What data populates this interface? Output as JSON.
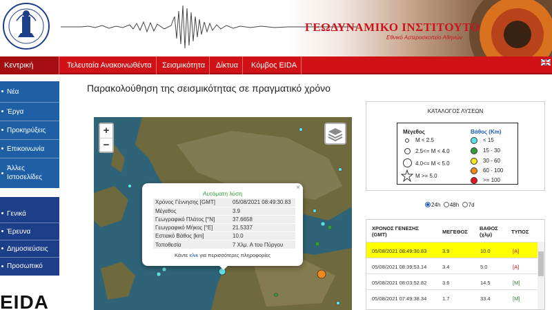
{
  "header": {
    "title": "ΓΕΩΔΥΝΑΜΙΚΟ ΙΝΣΤΙΤΟΥΤΟ",
    "subtitle": "Εθνικό Αστεροσκοπείο Αθηνών",
    "seal_text": "OBSERVATORY ATHENS"
  },
  "nav": {
    "items": [
      {
        "label": "Κεντρική Σελίδα"
      },
      {
        "label": "Τελευταία Ανακοινωθέντα"
      },
      {
        "label": "Σεισμικότητα"
      },
      {
        "label": "Δίκτυα"
      },
      {
        "label": "Κόμβος EIDA"
      }
    ]
  },
  "sidebar": {
    "group1": [
      "Νέα",
      "Έργα",
      "Προκηρύξεις",
      "Επικοινωνία",
      "Άλλες Ιστοσελίδες"
    ],
    "group2": [
      "Γενικά",
      "Έρευνα",
      "Δημοσιεύσεις",
      "Προσωπικό"
    ],
    "logo": "EIDA"
  },
  "main": {
    "title": "Παρακολούθηση της σεισμικότητας σε πραγματικό χρόνο"
  },
  "map": {
    "zoom_in": "+",
    "zoom_out": "−",
    "popup": {
      "title": "Αυτόματη λύση",
      "close": "×",
      "rows": [
        {
          "k": "Χρόνος Γέννησης [GMT]",
          "v": "05/08/2021 08:49:30.83"
        },
        {
          "k": "Μέγεθος",
          "v": "3.9"
        },
        {
          "k": "Γεωγραφικό Πλάτος [°N]",
          "v": "37.6658"
        },
        {
          "k": "Γεωγραφικό Μήκος [°E]",
          "v": "21.5337"
        },
        {
          "k": "Εστιακό Βάθος [km]",
          "v": "10.0"
        },
        {
          "k": "Τοποθεσία",
          "v": "7 Χλμ. Α του Πύργου"
        }
      ],
      "footer_pre": "Κάντε ",
      "footer_link": "κλικ",
      "footer_post": " για περισσότερες πληροφορίες"
    }
  },
  "legend": {
    "title": "ΚΑΤΑΛΟΓΟΣ ΛΥΣΕΩΝ",
    "magnitude_header": "Μέγεθος",
    "depth_header": "Βάθος (Km)",
    "magnitudes": [
      "M < 2.5",
      "2.5<= M < 4.0",
      "4.0<= M < 5.0",
      "M >= 5.0"
    ],
    "depths": [
      {
        "label": "< 15",
        "color": "#5ee0e6"
      },
      {
        "label": "15 - 30",
        "color": "#2e9e3a"
      },
      {
        "label": "30 - 60",
        "color": "#f3ea1c"
      },
      {
        "label": "60 - 100",
        "color": "#f08a1c"
      },
      {
        "label": ">= 100",
        "color": "#e3141b"
      }
    ]
  },
  "filters": {
    "options": [
      "24h",
      "48h",
      "7d"
    ],
    "selected": "24h"
  },
  "solutions": {
    "headers": {
      "time": "ΧΡΟΝΟΣ ΓΕΝΕΣΗΣ",
      "time_unit": "(GMT)",
      "mag": "ΜΕΓΕΘΟΣ",
      "depth": "ΒΑΘΟΣ",
      "depth_unit": "(χλμ)",
      "type": "ΤΥΠΟΣ"
    },
    "rows": [
      {
        "time": "05/08/2021 08:49:30.83",
        "mag": "3.9",
        "depth": "10.0",
        "type": "[A]",
        "highlight": true
      },
      {
        "time": "05/08/2021 08:39:53.14",
        "mag": "3.4",
        "depth": "5.0",
        "type": "[A]"
      },
      {
        "time": "05/08/2021 08:03:52.82",
        "mag": "3.6",
        "depth": "14.5",
        "type": "[M]"
      },
      {
        "time": "05/08/2021 07:49:38.34",
        "mag": "1.7",
        "depth": "33.4",
        "type": "[M]"
      }
    ]
  }
}
